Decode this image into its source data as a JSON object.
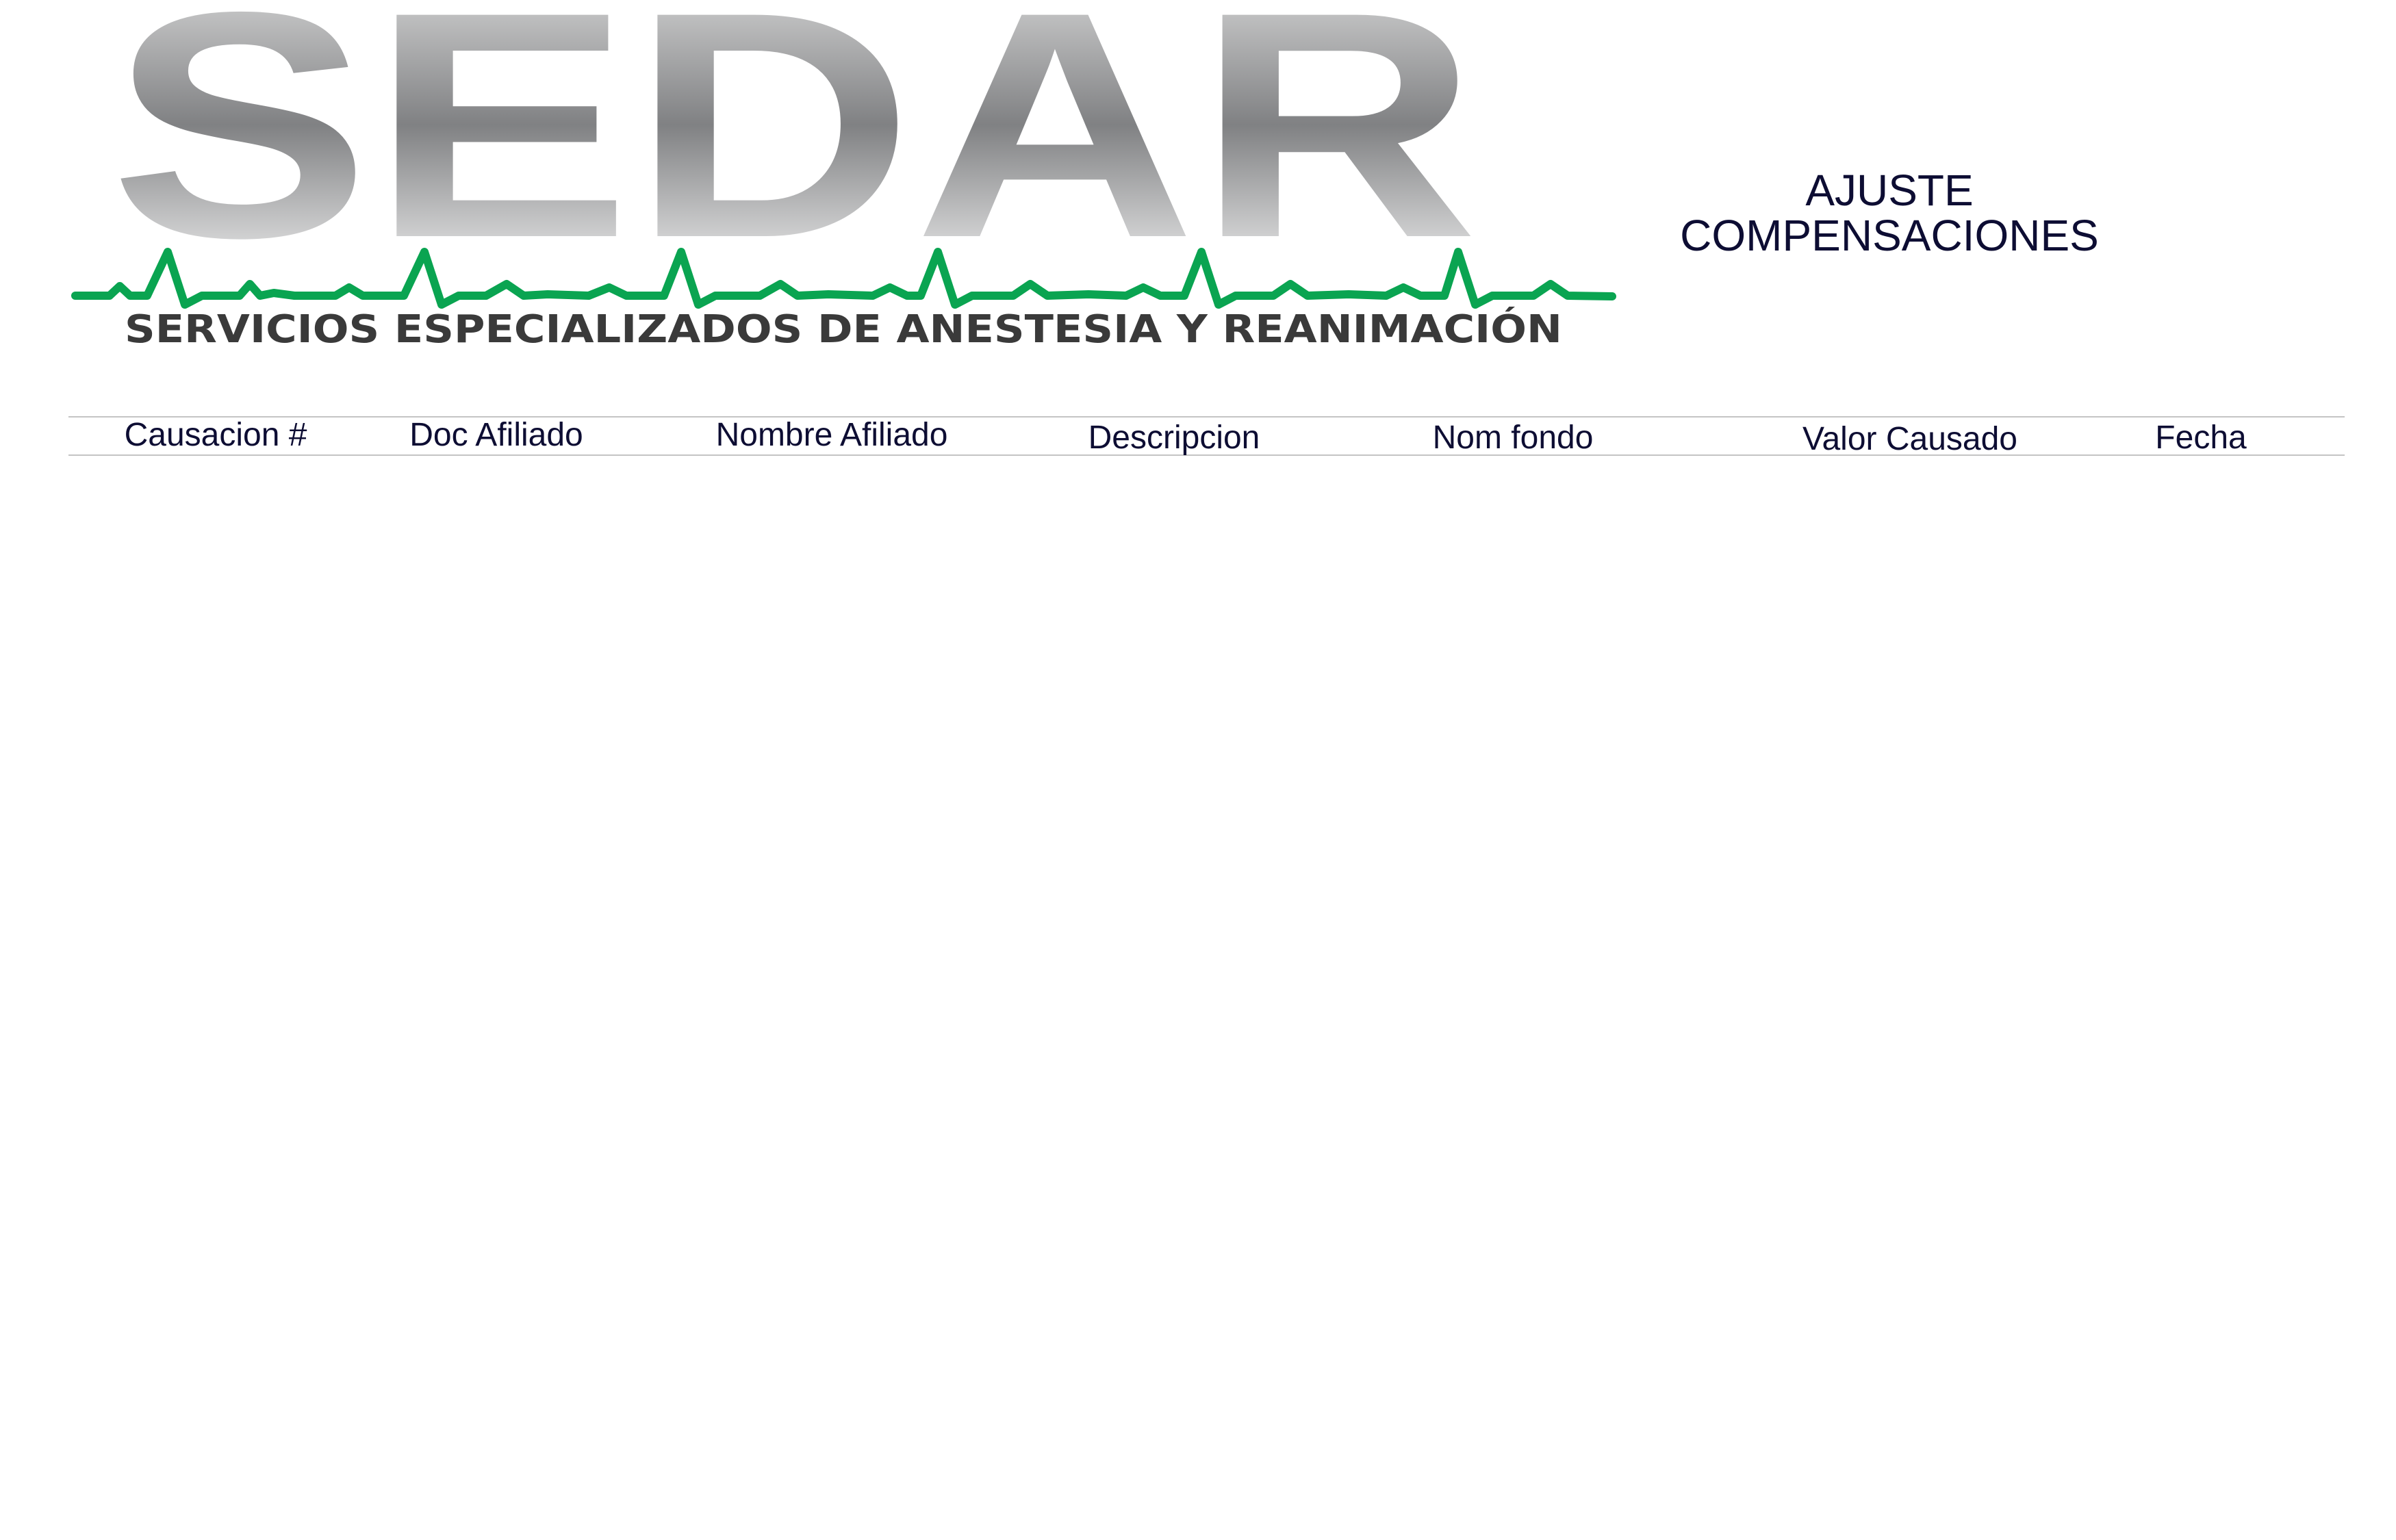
{
  "logo": {
    "wordmark": "SEDAR",
    "tagline": "SERVICIOS ESPECIALIZADOS DE ANESTESIA Y REANIMACIÓN",
    "colors": {
      "wordmark_gray": "#8a8b8d",
      "heartbeat_green": "#0aa451",
      "tagline": "#3a3a3a"
    }
  },
  "report": {
    "title_line1": "AJUSTE",
    "title_line2": "COMPENSACIONES"
  },
  "table": {
    "columns": [
      "Causacion #",
      "Doc Afiliado",
      "Nombre Afiliado",
      "Descripcion",
      "Nom fondo",
      "Valor Causado",
      "Fecha"
    ]
  },
  "colors": {
    "text": "#0d0d33",
    "rule": "#c4c4c4",
    "background": "#ffffff"
  }
}
